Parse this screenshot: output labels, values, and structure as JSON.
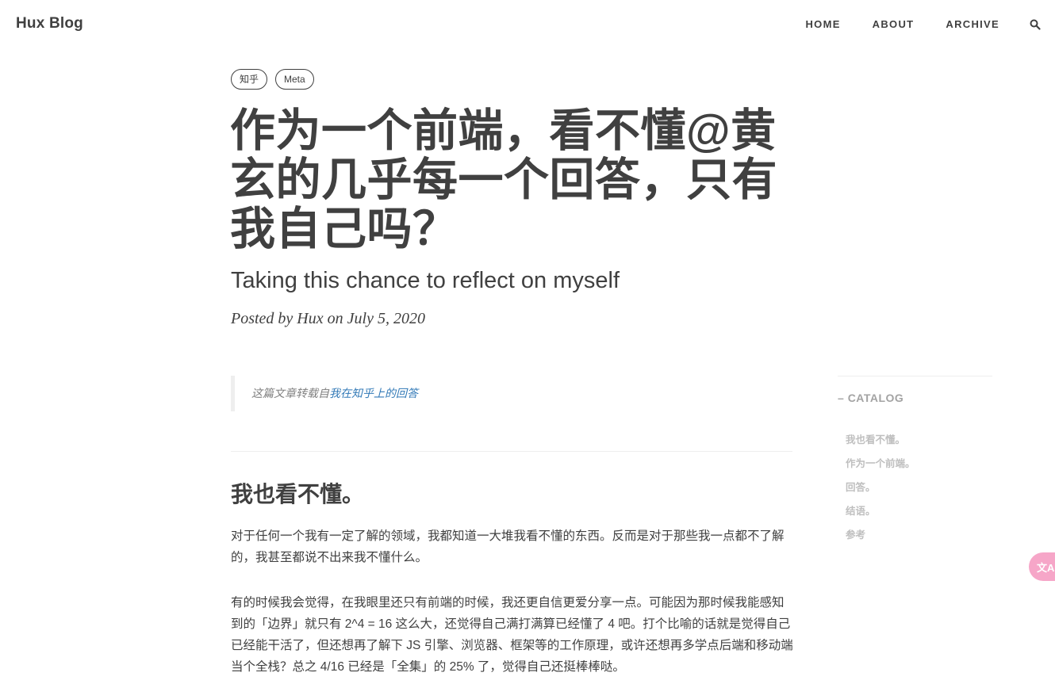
{
  "nav": {
    "brand": "Hux Blog",
    "links": [
      "HOME",
      "ABOUT",
      "ARCHIVE"
    ]
  },
  "header": {
    "tags": [
      "知乎",
      "Meta"
    ],
    "title": "作为一个前端，看不懂@黄玄的几乎每一个回答，只有我自己吗？",
    "subtitle": "Taking this chance to reflect on myself",
    "meta": "Posted by Hux on July 5, 2020"
  },
  "article": {
    "quote_prefix": "这篇文章转载自",
    "quote_link": "我在知乎上的回答",
    "section_heading": "我也看不懂。",
    "paragraphs": [
      "对于任何一个我有一定了解的领域，我都知道一大堆我看不懂的东西。反而是对于那些我一点都不了解的，我甚至都说不出来我不懂什么。",
      "有的时候我会觉得，在我眼里还只有前端的时候，我还更自信更爱分享一点。可能因为那时候我能感知到的「边界」就只有 2^4 = 16 这么大，还觉得自己满打满算已经懂了 4 吧。打个比喻的话就是觉得自己已经能干活了，但还想再了解下 JS 引擎、浏览器、框架等的工作原理，或许还想再多学点后端和移动端当个全栈？总之 4/16 已经是「全集」的 25% 了，觉得自己还挺棒棒哒。"
    ]
  },
  "catalog": {
    "title": "CATALOG",
    "items": [
      "我也看不懂。",
      "作为一个前端。",
      "回答。",
      "结语。",
      "参考"
    ]
  },
  "widget": {
    "label": "文A"
  },
  "colors": {
    "text": "#404040",
    "link": "#337ab7",
    "muted": "#bfbfbf",
    "widget": "#f6a6c8"
  }
}
